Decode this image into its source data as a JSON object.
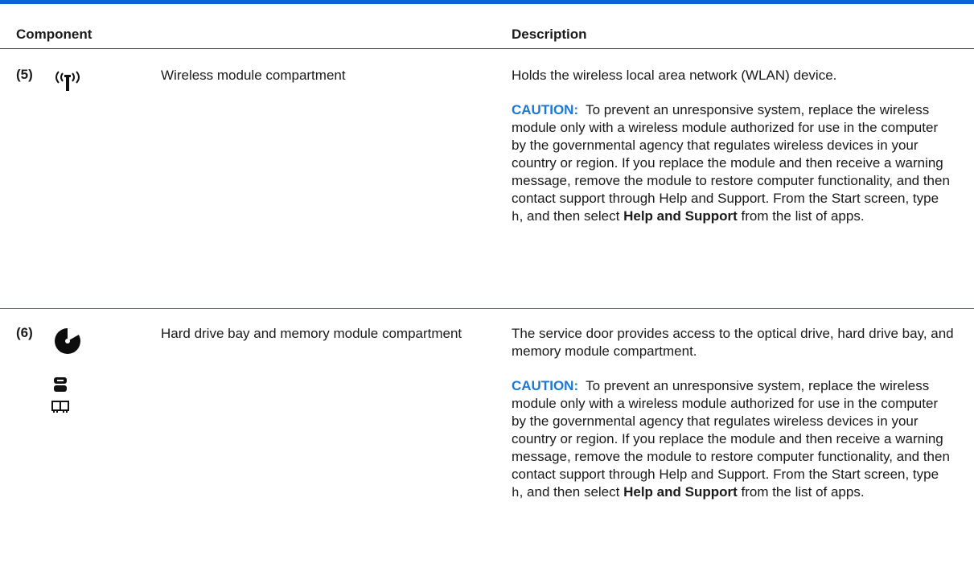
{
  "header": {
    "component_label": "Component",
    "description_label": "Description"
  },
  "rows": [
    {
      "number": "(5)",
      "icon": "wireless-icon",
      "name": "Wireless module compartment",
      "desc_main": "Holds the wireless local area network (WLAN) device.",
      "caution": {
        "label": "CAUTION:",
        "text_a": "To prevent an unresponsive system, replace the wireless module only with a wireless module authorized for use in the computer by the governmental agency that regulates wireless devices in your country or region. If you replace the module and then receive a warning message, remove the module to restore computer functionality, and then contact support through Help and Support. From the Start screen, type ",
        "code": "h",
        "text_b": ", and then select ",
        "strong": "Help and Support",
        "text_c": " from the list of apps."
      }
    },
    {
      "number": "(6)",
      "icons": [
        "optical-drive-icon",
        "hard-drive-icon",
        "memory-module-icon"
      ],
      "name": "Hard drive bay and memory module compartment",
      "desc_main": "The service door provides access to the optical drive, hard drive bay, and memory module compartment.",
      "caution": {
        "label": "CAUTION:",
        "text_a": "To prevent an unresponsive system, replace the wireless module only with a wireless module authorized for use in the computer by the governmental agency that regulates wireless devices in your country or region. If you replace the module and then receive a warning message, remove the module to restore computer functionality, and then contact support through Help and Support. From the Start screen, type ",
        "code": "h",
        "text_b": ", and then select ",
        "strong": "Help and Support",
        "text_c": " from the list of apps."
      }
    }
  ],
  "colors": {
    "rule_blue": "#0a66d8",
    "caution_blue": "#1a78d6",
    "text": "#1a1a1a"
  }
}
